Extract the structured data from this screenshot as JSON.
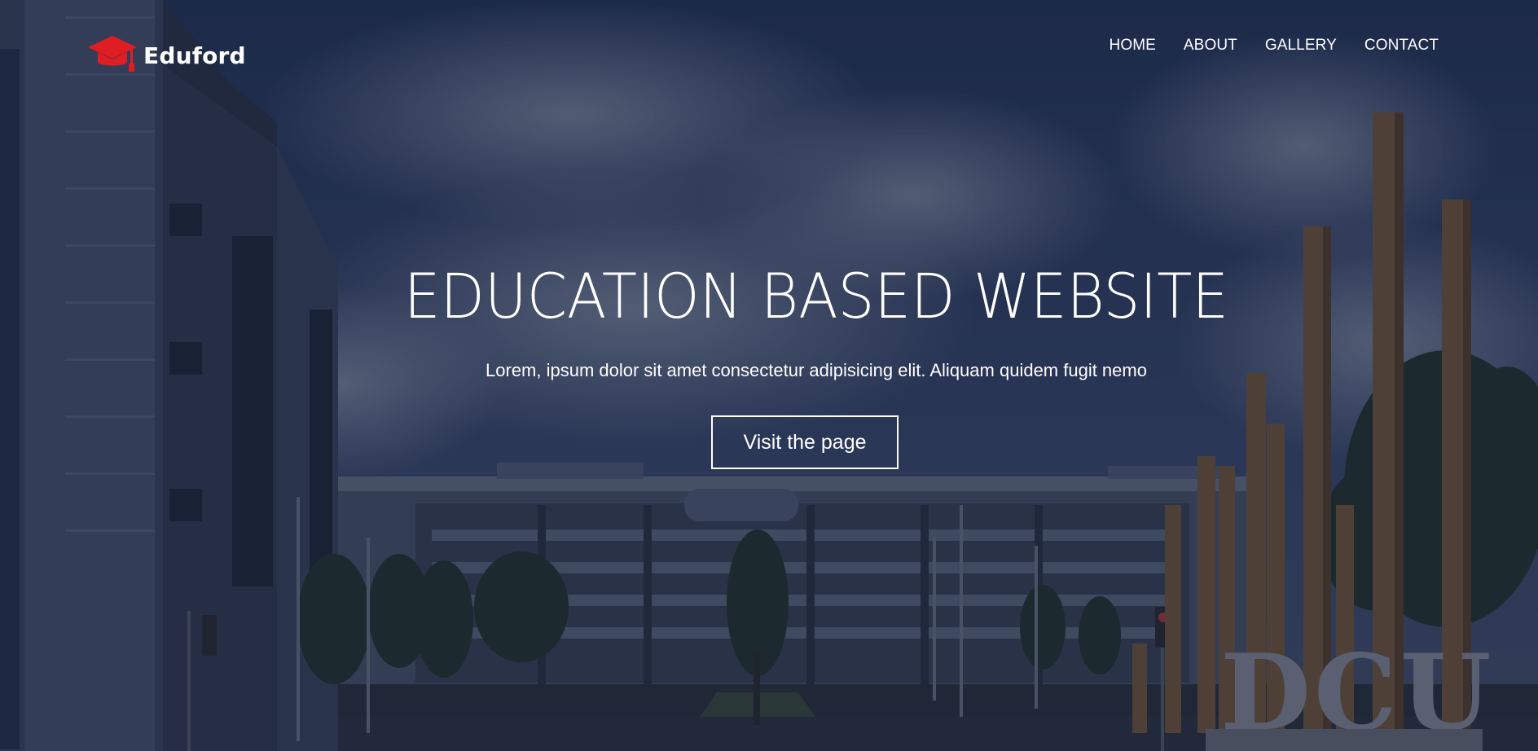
{
  "brand": {
    "name": "Eduford",
    "icon": "graduation-cap-icon",
    "accent_color": "#e11d24"
  },
  "nav": {
    "items": [
      {
        "label": "HOME"
      },
      {
        "label": "ABOUT"
      },
      {
        "label": "GALLERY"
      },
      {
        "label": "CONTACT"
      }
    ]
  },
  "hero": {
    "title": "EDUCATION BASED WEBSITE",
    "subtitle": "Lorem, ipsum dolor sit amet consectetur adipisicing elit. Aliquam quidem fugit nemo",
    "button_label": "Visit the page",
    "background_sign": "DCU"
  },
  "colors": {
    "text": "#ffffff",
    "overlay": "#141c34",
    "sky": "#2b3d66"
  }
}
